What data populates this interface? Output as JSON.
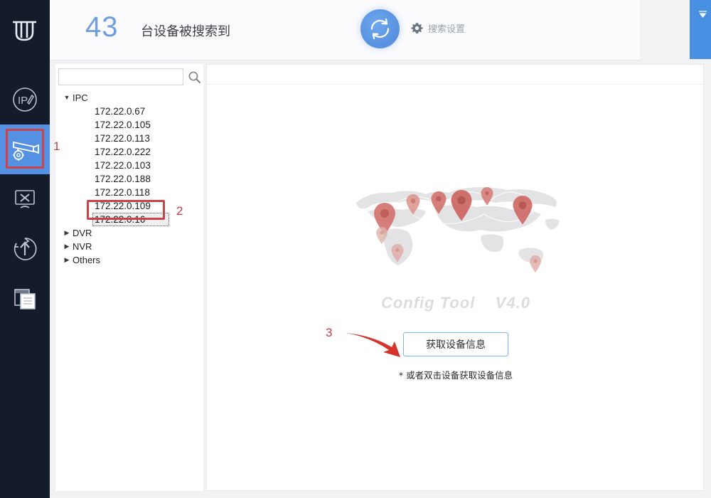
{
  "window": {
    "buttons": [
      {
        "name": "collapse-button",
        "glyph": "▼"
      },
      {
        "name": "minimize-button",
        "glyph": "–"
      },
      {
        "name": "close-button",
        "glyph": "✕"
      }
    ]
  },
  "header": {
    "device_count": "43",
    "count_suffix": "台设备被搜索到",
    "refresh_icon": "refresh-icon",
    "settings_label": "搜索设置",
    "settings_icon": "gear-icon"
  },
  "sidebar": {
    "logo_icon": "app-logo-icon",
    "items": [
      {
        "name": "sidebar-item-ip-modify",
        "icon": "ip-edit-icon",
        "selected": false
      },
      {
        "name": "sidebar-item-device-config",
        "icon": "camera-gear-icon",
        "selected": true
      },
      {
        "name": "sidebar-item-tools",
        "icon": "monitor-tools-icon",
        "selected": false
      },
      {
        "name": "sidebar-item-upgrade",
        "icon": "upload-arrow-icon",
        "selected": false
      },
      {
        "name": "sidebar-item-logs",
        "icon": "documents-icon",
        "selected": false
      }
    ]
  },
  "tree_panel": {
    "search": {
      "value": "",
      "placeholder": "",
      "icon": "search-icon"
    },
    "groups": [
      {
        "label": "IPC",
        "expanded": true,
        "caret": "▼",
        "devices": [
          "172.22.0.67",
          "172.22.0.105",
          "172.22.0.113",
          "172.22.0.222",
          "172.22.0.103",
          "172.22.0.188",
          "172.22.0.118",
          "172.22.0.109",
          "172.22.0.16"
        ],
        "selected_device": "172.22.0.16"
      },
      {
        "label": "DVR",
        "expanded": false,
        "caret": "▶",
        "devices": []
      },
      {
        "label": "NVR",
        "expanded": false,
        "caret": "▶",
        "devices": []
      },
      {
        "label": "Others",
        "expanded": false,
        "caret": "▶",
        "devices": []
      }
    ]
  },
  "main": {
    "brand_text": "Config Tool    V4.0",
    "get_info_button": "获取设备信息",
    "hint_text": "* 或者双击设备获取设备信息",
    "map_pins": 10
  },
  "annotations": [
    {
      "name": "annotation-1",
      "number": "1"
    },
    {
      "name": "annotation-2",
      "number": "2"
    },
    {
      "name": "annotation-3",
      "number": "3"
    }
  ],
  "colors": {
    "accent_blue": "#5591e3",
    "rail_dark": "#141b2b",
    "annotation_red": "#c0404a",
    "count_blue": "#6f9ede",
    "pin_red": "#cf6a65"
  }
}
